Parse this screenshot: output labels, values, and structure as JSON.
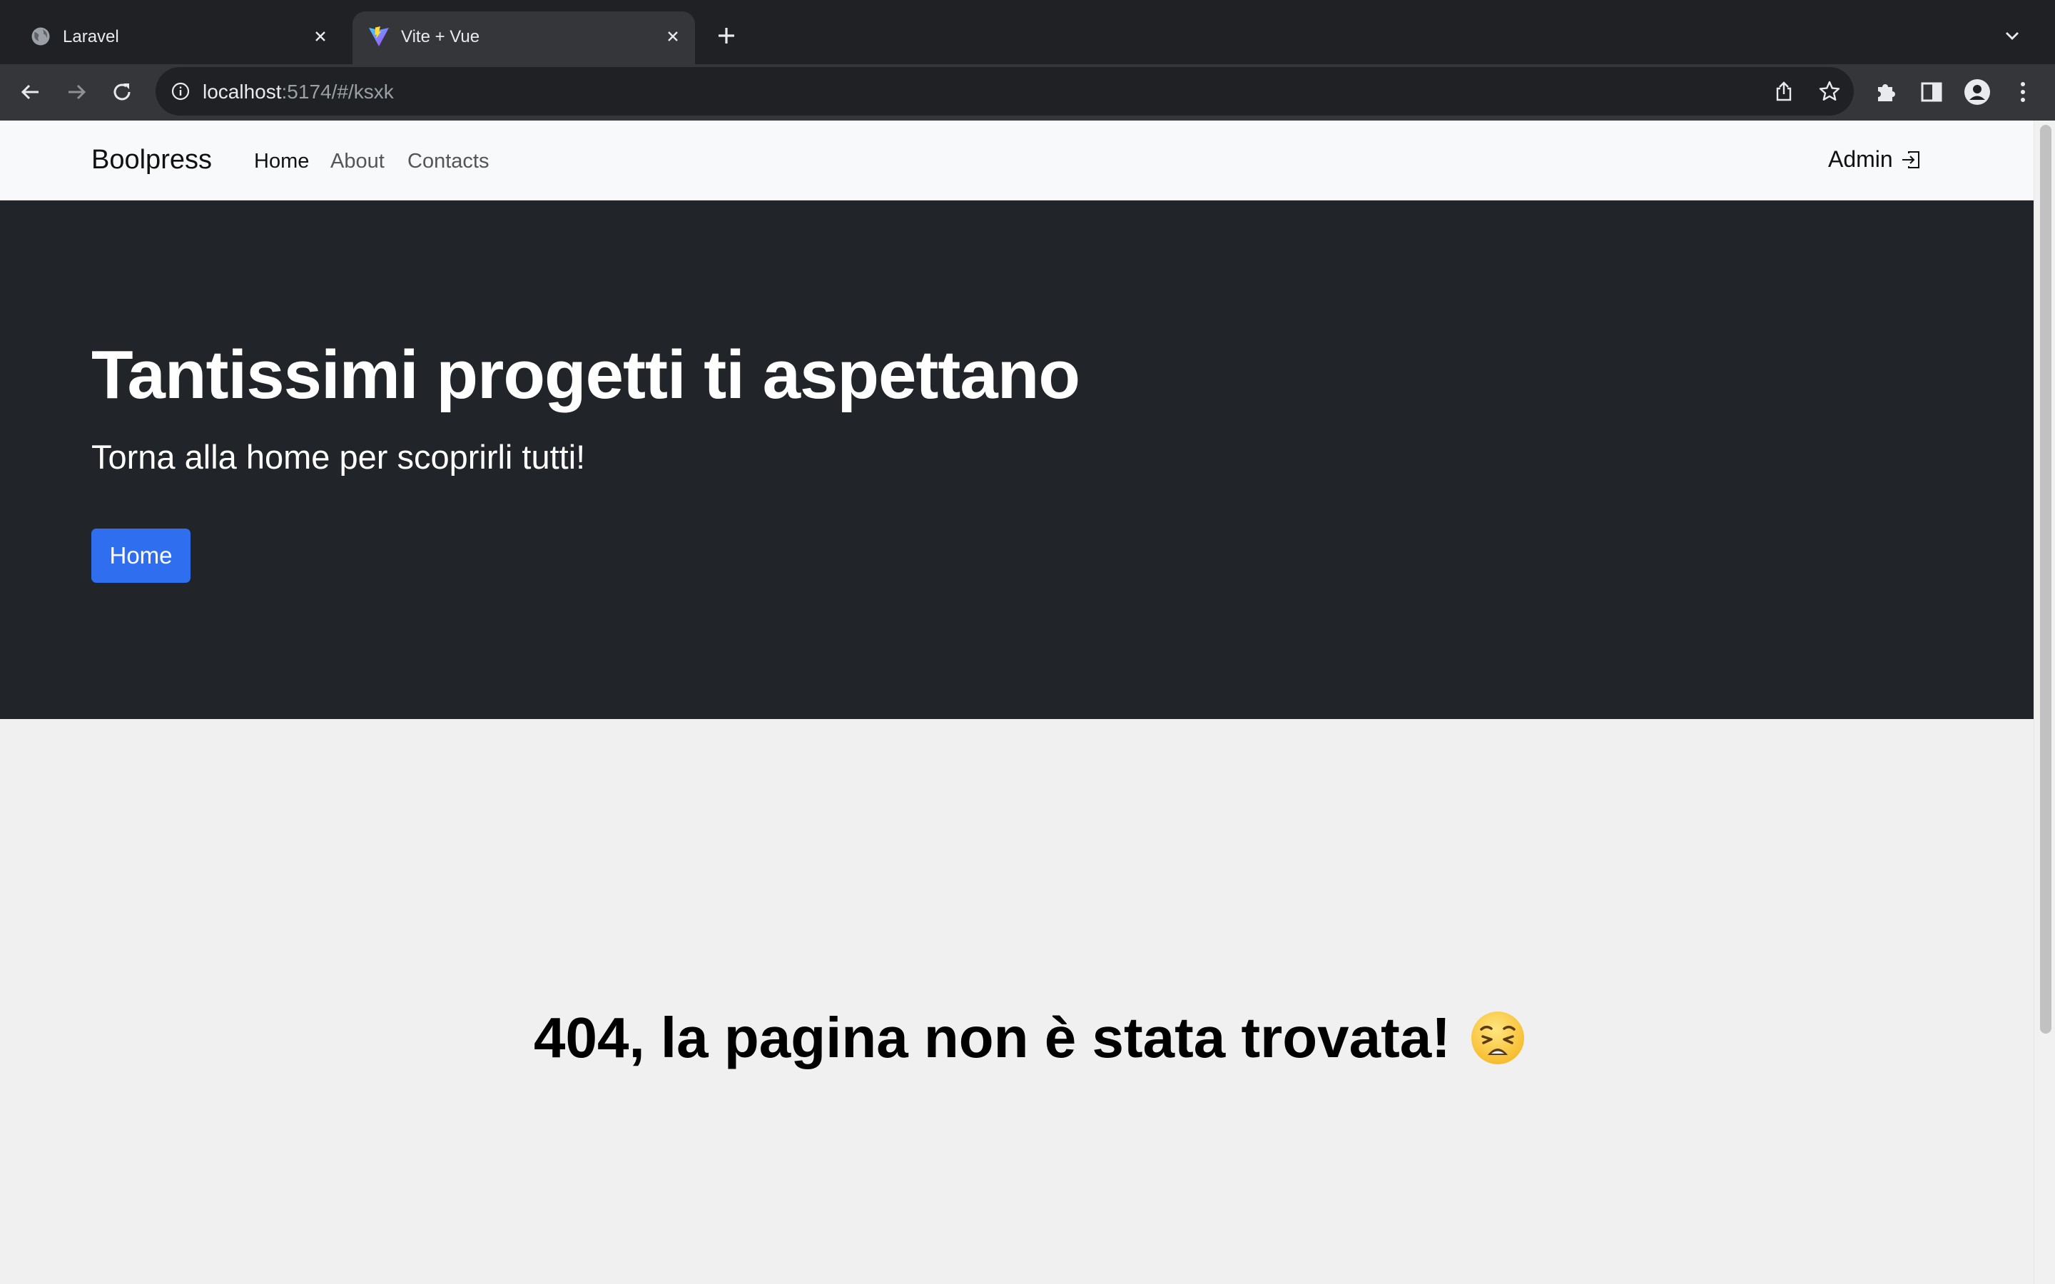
{
  "browser": {
    "tabs": [
      {
        "title": "Laravel",
        "icon": "globe-icon"
      },
      {
        "title": "Vite + Vue",
        "icon": "vite-logo-icon"
      }
    ],
    "new_tab": "new-tab-icon",
    "address": {
      "host": "localhost",
      "rest": ":5174/#/ksxk"
    }
  },
  "navbar": {
    "brand": "Boolpress",
    "links": [
      {
        "label": "Home",
        "active": true
      },
      {
        "label": "About",
        "active": false
      },
      {
        "label": "Contacts",
        "active": false
      }
    ],
    "admin_label": "Admin"
  },
  "hero": {
    "title": "Tantissimi progetti ti aspettano",
    "subtitle": "Torna alla home per scoprirli tutti!",
    "button_label": "Home",
    "button_color": "#2f6fef",
    "background": "#212529"
  },
  "error": {
    "message": "404, la pagina non è stata trovata!",
    "emoji_icon": "weary-face-icon"
  }
}
